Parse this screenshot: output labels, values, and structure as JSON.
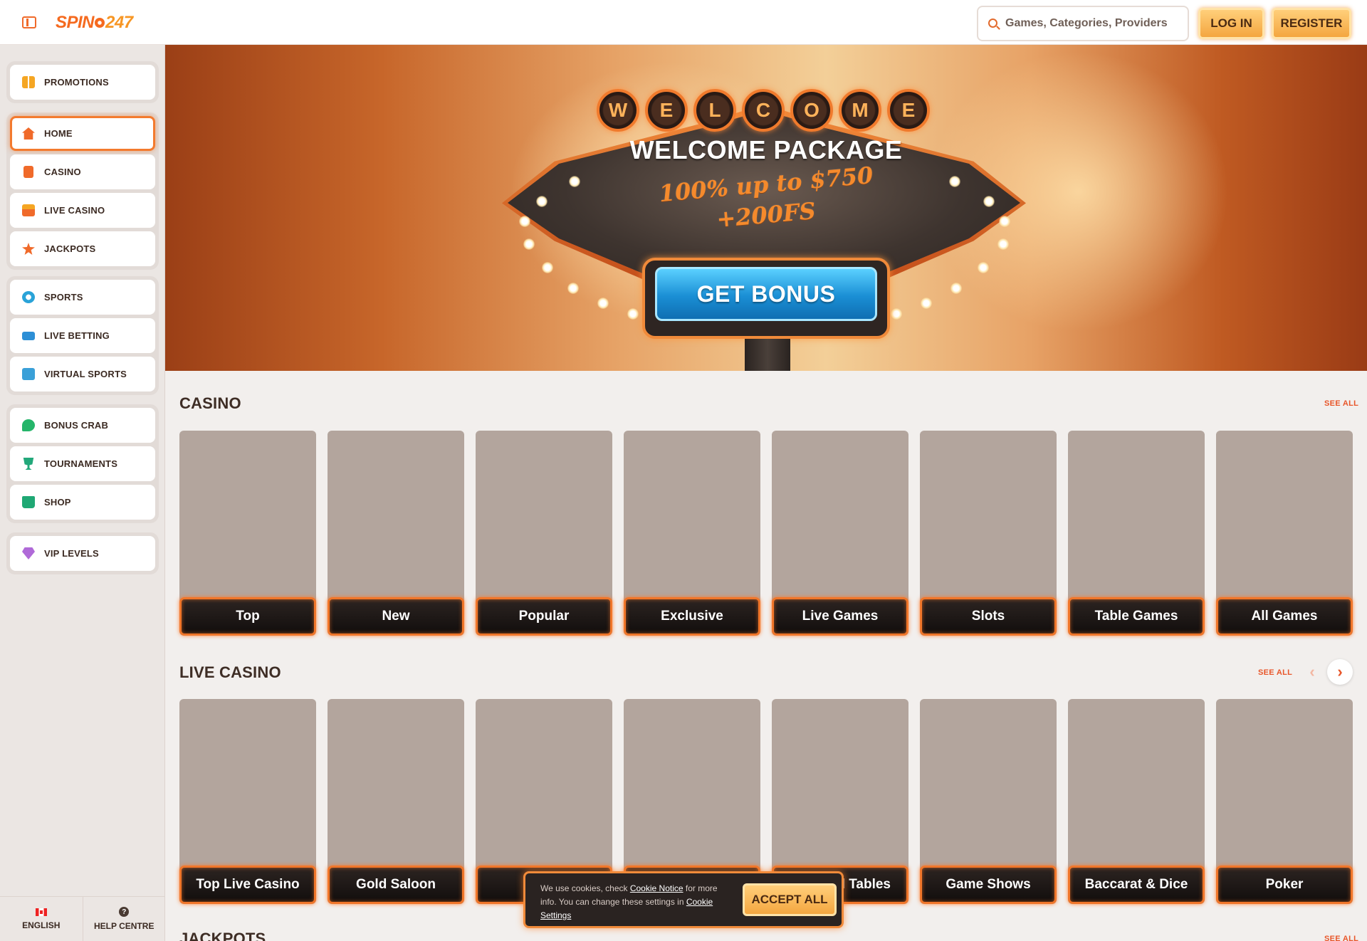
{
  "header": {
    "logo_text_a": "SPIN",
    "logo_text_b": "247",
    "search_placeholder": "Games, Categories, Providers",
    "login_label": "LOG IN",
    "register_label": "REGISTER"
  },
  "sidebar": {
    "groups": [
      [
        {
          "label": "PROMOTIONS",
          "icon": "gift-icon"
        }
      ],
      [
        {
          "label": "HOME",
          "icon": "home-icon",
          "active": true
        },
        {
          "label": "CASINO",
          "icon": "casino-icon"
        },
        {
          "label": "LIVE CASINO",
          "icon": "live-casino-icon"
        },
        {
          "label": "JACKPOTS",
          "icon": "jackpot-icon"
        }
      ],
      [
        {
          "label": "SPORTS",
          "icon": "sports-icon"
        },
        {
          "label": "LIVE BETTING",
          "icon": "live-betting-icon"
        },
        {
          "label": "VIRTUAL SPORTS",
          "icon": "virtual-sports-icon"
        }
      ],
      [
        {
          "label": "BONUS CRAB",
          "icon": "bonus-crab-icon"
        },
        {
          "label": "TOURNAMENTS",
          "icon": "trophy-icon"
        },
        {
          "label": "SHOP",
          "icon": "shop-icon"
        }
      ],
      [
        {
          "label": "VIP LEVELS",
          "icon": "diamond-icon"
        }
      ]
    ],
    "footer": {
      "language": "ENGLISH",
      "help": "HELP CENTRE"
    }
  },
  "hero": {
    "welcome_letters": [
      "W",
      "E",
      "L",
      "C",
      "O",
      "M",
      "E"
    ],
    "title": "WELCOME PACKAGE",
    "offer_line1": "100% up to $750",
    "offer_line2": "+200FS",
    "cta": "GET BONUS"
  },
  "casino": {
    "title": "CASINO",
    "see_all": "SEE ALL",
    "cards": [
      "Top",
      "New",
      "Popular",
      "Exclusive",
      "Live Games",
      "Slots",
      "Table Games",
      "All Games"
    ]
  },
  "live_casino": {
    "title": "LIVE CASINO",
    "see_all": "SEE ALL",
    "cards": [
      "Top Live Casino",
      "Gold Saloon",
      "",
      "",
      "al Tables",
      "Game Shows",
      "Baccarat & Dice",
      "Poker"
    ]
  },
  "jackpots": {
    "title": "JACKPOTS",
    "see_all": "SEE ALL"
  },
  "cookie": {
    "text_before": "We use cookies, check ",
    "notice_link": "Cookie Notice",
    "text_middle": " for more info. You can change these settings in ",
    "settings_link": "Cookie Settings",
    "accept": "ACCEPT ALL"
  },
  "colors": {
    "accent": "#f06a2a",
    "cta_blue": "#1a8ed4",
    "card_placeholder": "#b3a59d"
  }
}
